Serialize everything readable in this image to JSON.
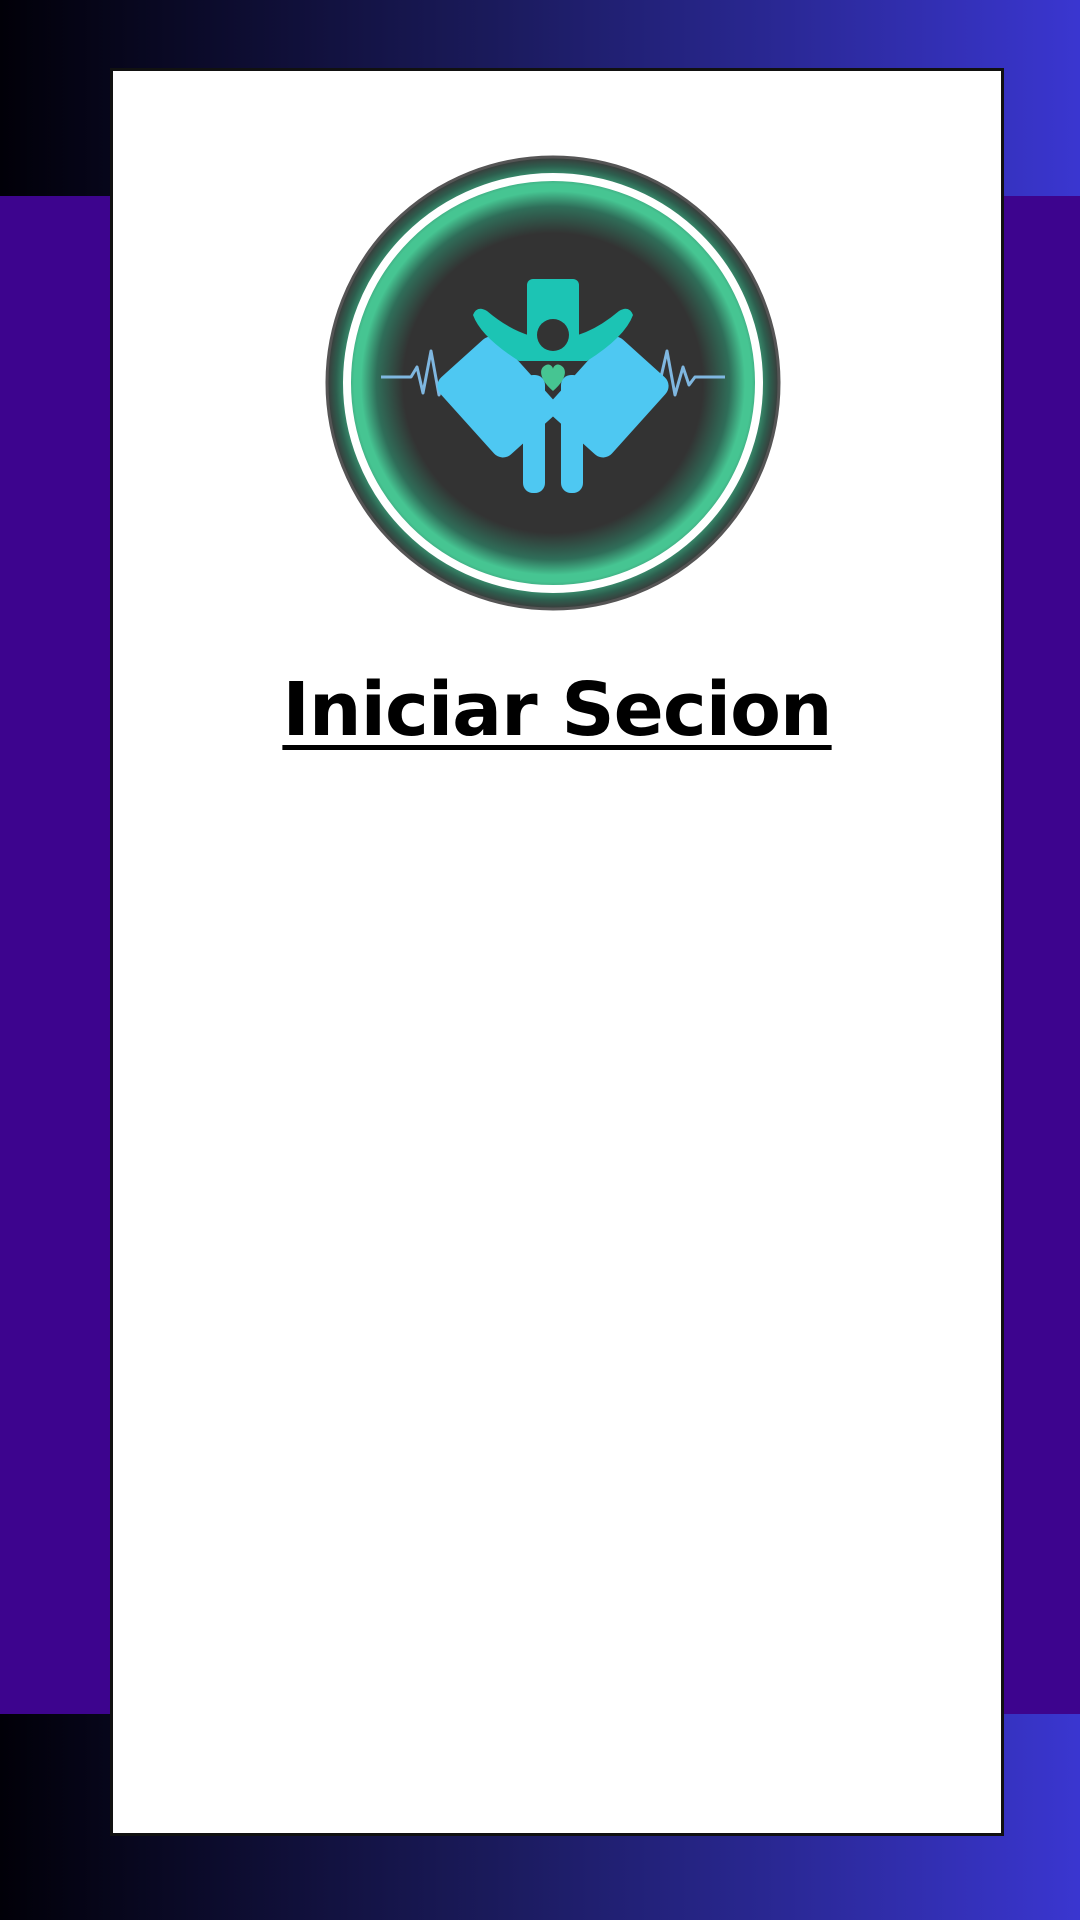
{
  "screen": {
    "title": "Iniciar Secion"
  },
  "logo": {
    "icon": "medical-heartbeat-logo-icon"
  },
  "colors": {
    "background_purple": "#3d048e",
    "gradient_dark": "#010008",
    "gradient_blue": "#3a36d0",
    "card_white": "#ffffff",
    "logo_dark": "#333333",
    "logo_ring_green": "#46c592",
    "logo_figure_cyan": "#4ec8f2",
    "logo_figure_teal": "#1cc4b4"
  }
}
